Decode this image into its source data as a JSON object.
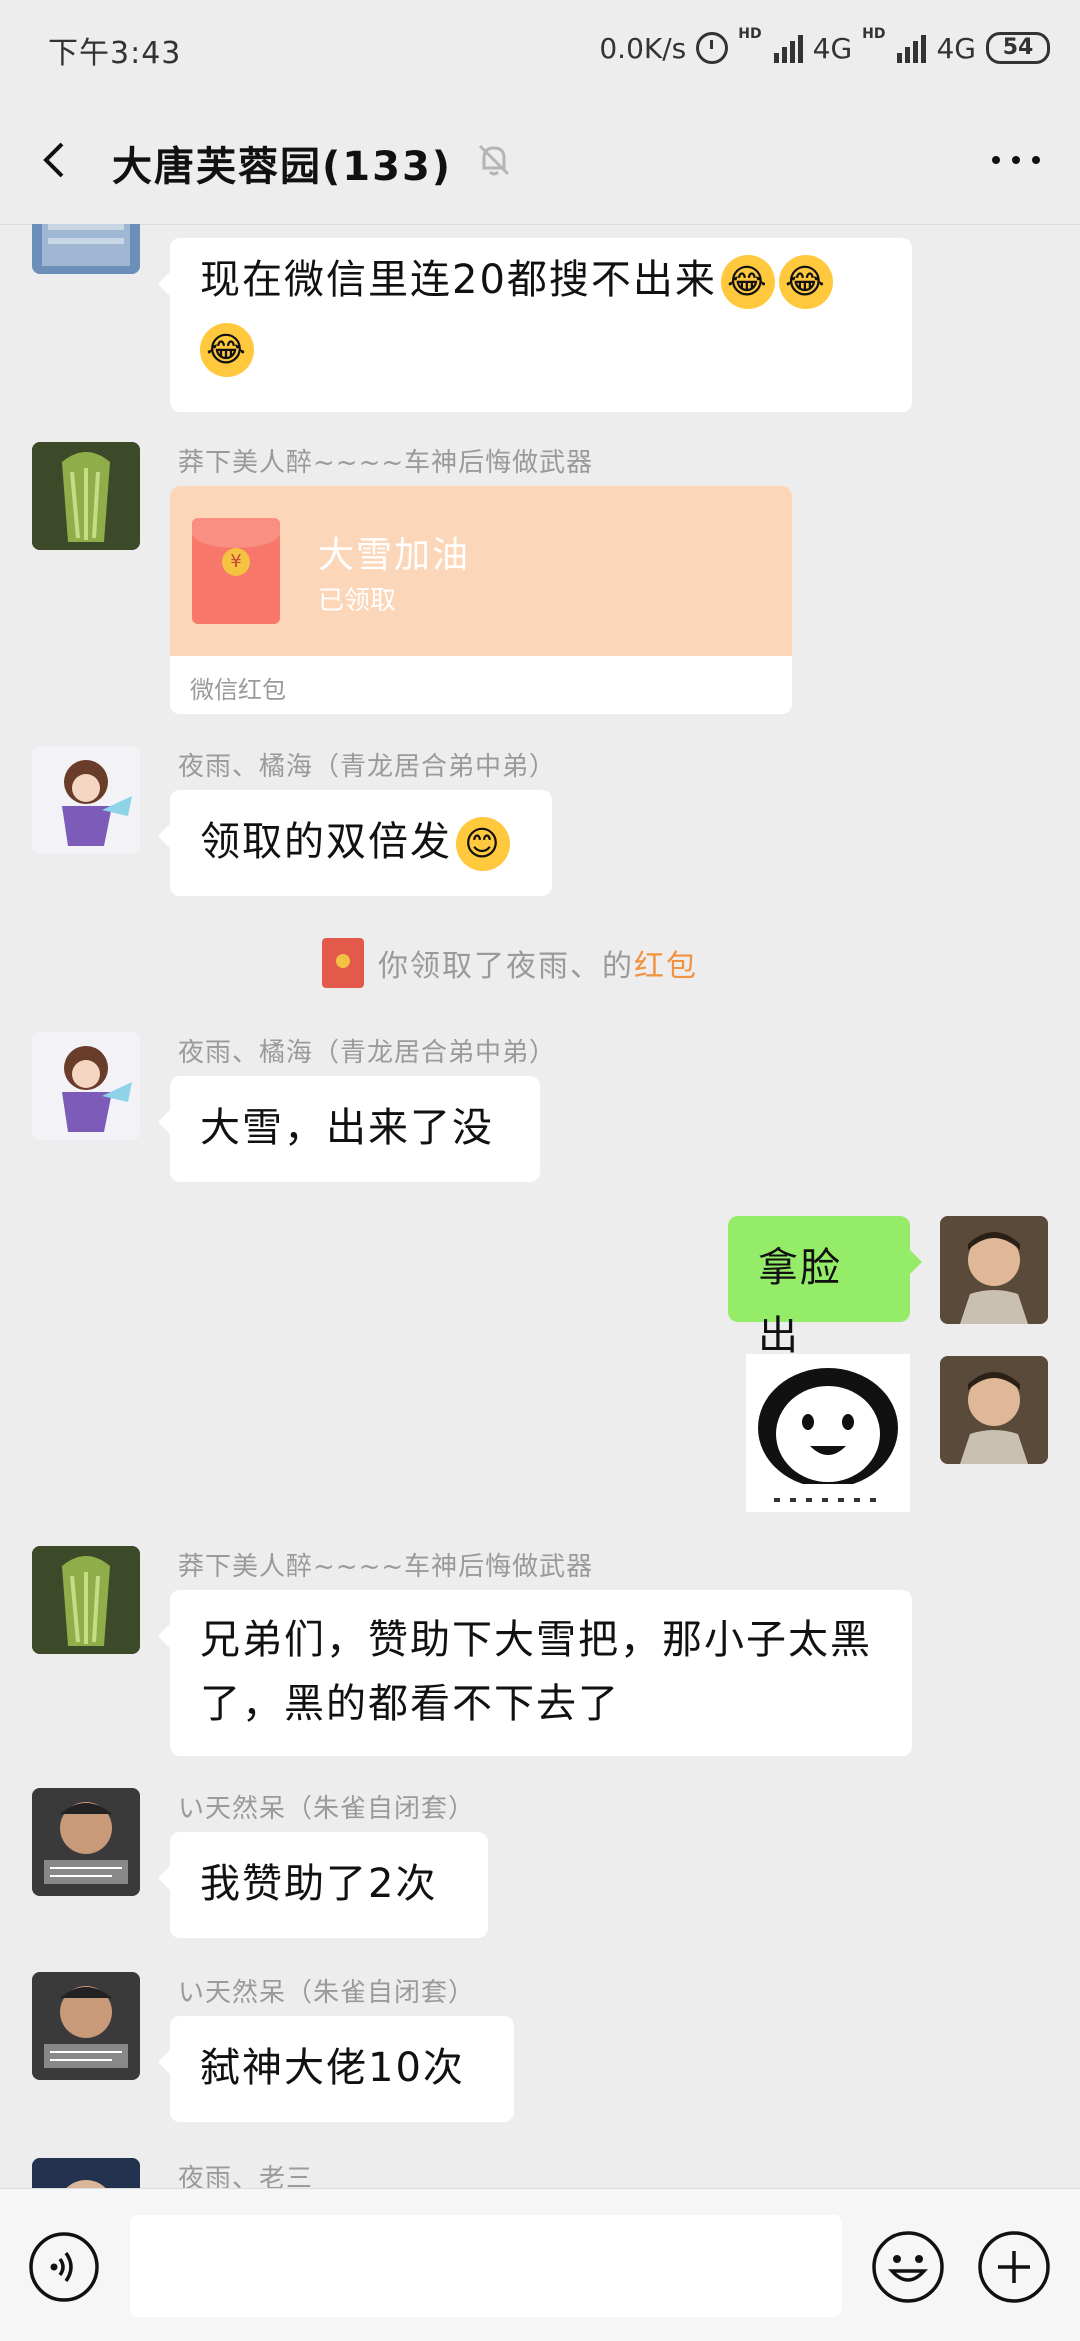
{
  "status": {
    "time": "下午3:43",
    "net_speed": "0.0K/s",
    "hd1": "HD",
    "net1": "4G",
    "hd2": "HD",
    "net2": "4G",
    "battery": "54"
  },
  "header": {
    "title": "大唐芙蓉园(133)"
  },
  "messages": [
    {
      "text": "现在微信里连20都搜不出来"
    },
    {
      "nick": "莽下美人醉~~~~车神后悔做武器",
      "redpacket": {
        "title": "大雪加油",
        "status": "已领取",
        "footer": "微信红包"
      }
    },
    {
      "nick": "夜雨、橘海（青龙居合弟中弟）",
      "text": "领取的双倍发"
    },
    {
      "system": {
        "prefix": "你领取了夜雨、的",
        "link": "红包"
      }
    },
    {
      "nick": "夜雨、橘海（青龙居合弟中弟）",
      "text": "大雪，出来了没"
    },
    {
      "text": "拿脸出"
    },
    {
      "nick": "莽下美人醉~~~~车神后悔做武器",
      "text": "兄弟们，赞助下大雪把，那小子太黑了，黑的都看不下去了"
    },
    {
      "nick": "い天然呆（朱雀自闭套）",
      "text": "我赞助了2次"
    },
    {
      "nick": "い天然呆（朱雀自闭套）",
      "text": "弑神大佬10次"
    },
    {
      "nick": "夜雨、老三"
    }
  ],
  "input": {
    "value": ""
  },
  "colors": {
    "background": "#ededed",
    "bubble_self": "#95ec69",
    "bubble_other": "#ffffff",
    "redpacket": "#fbd6b8",
    "link": "#f09340"
  }
}
